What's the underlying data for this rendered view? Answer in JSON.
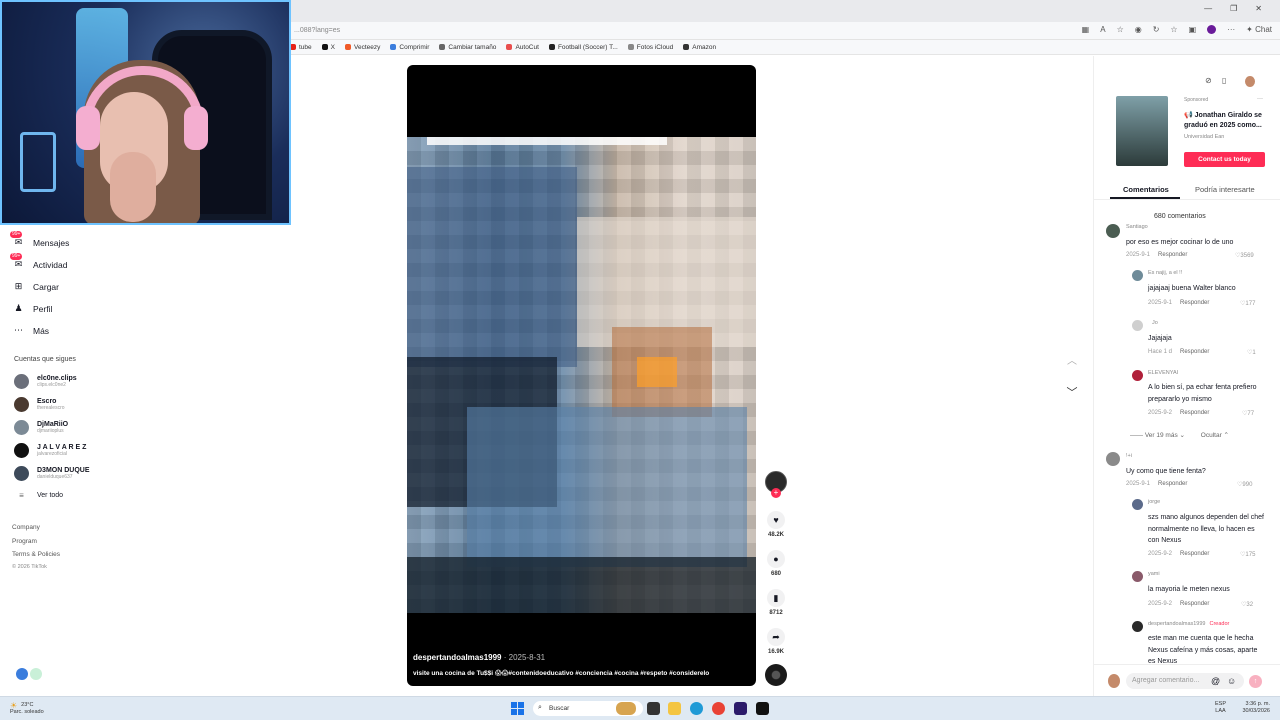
{
  "browser": {
    "url": "...088?lang=es",
    "bookmarks": [
      {
        "label": "tube",
        "color": "#e62117"
      },
      {
        "label": "X",
        "color": "#111111"
      },
      {
        "label": "Vecteezy",
        "color": "#f05a28"
      },
      {
        "label": "Comprimir",
        "color": "#3b7ddd"
      },
      {
        "label": "Cambiar tamaño",
        "color": "#666666"
      },
      {
        "label": "AutoCut",
        "color": "#e94e4e"
      },
      {
        "label": "Football (Soccer) T...",
        "color": "#222222"
      },
      {
        "label": "Fotos iCloud",
        "color": "#888888"
      },
      {
        "label": "Amazon",
        "color": "#333333"
      }
    ],
    "chat_label": "Chat"
  },
  "sidebar": {
    "nav": [
      {
        "label": "Mensajes",
        "icon": "message-icon",
        "badge": "99+"
      },
      {
        "label": "Actividad",
        "icon": "inbox-icon",
        "badge": "99+"
      },
      {
        "label": "Cargar",
        "icon": "upload-icon",
        "badge": ""
      },
      {
        "label": "Perfil",
        "icon": "profile-icon",
        "badge": ""
      },
      {
        "label": "Más",
        "icon": "more-icon",
        "badge": ""
      }
    ],
    "following_title": "Cuentas que sigues",
    "following": [
      {
        "name": "elc0ne.clips",
        "handle": "clips.elc0ne2",
        "color": "#6b6f7a"
      },
      {
        "name": "Escro",
        "handle": "therealescro",
        "color": "#4a3a30"
      },
      {
        "name": "DjMaRiiO",
        "handle": "djmariioplus",
        "color": "#7c8a96"
      },
      {
        "name": "J A L V A R E Z",
        "handle": "jalvarezoficial",
        "color": "#111111"
      },
      {
        "name": "D3MON DUQUE",
        "handle": "danielduque637",
        "color": "#3d4a5a"
      }
    ],
    "see_all": "Ver todo",
    "footer": [
      "Company",
      "Program",
      "Terms & Policies",
      "© 2026 TikTok"
    ]
  },
  "video": {
    "author": "despertandoalmas1999",
    "date": "· 2025-8-31",
    "caption": "visite una cocina de Tu$$i 😱😱#contenidoeducativo #conciencia #cocina #respeto #considerelo"
  },
  "actions": {
    "likes": "48.2K",
    "comments": "680",
    "saves": "8712",
    "shares": "16.9K"
  },
  "right_panel": {
    "ad": {
      "sponsored": "Sponsored",
      "title": "📢 Jonathan Giraldo se graduó en 2025 como...",
      "advertiser": "Universidad Ean",
      "cta": "Contact us today"
    },
    "tabs": [
      "Comentarios",
      "Podría interesarte"
    ],
    "comment_count": "680 comentarios",
    "comments": [
      {
        "user": "Santiago",
        "text": "por eso es mejor cocinar lo de uno",
        "date": "2025-9-1",
        "reply": "Responder",
        "likes": "3569"
      },
      {
        "user": "Es najij, a el !!",
        "text": "jajajaaj buena Walter blanco",
        "date": "2025-9-1",
        "reply": "Responder",
        "likes": "177"
      },
      {
        "user": "Jo",
        "text": "Jajajaja",
        "date": "Hace 1 d",
        "reply": "Responder",
        "likes": "1"
      },
      {
        "user": "ELEVENYAI",
        "text": "A lo bien sí, pa echar fenta prefiero prepararlo yo mismo",
        "date": "2025-9-2",
        "reply": "Responder",
        "likes": "77"
      },
      {
        "user": "!+i",
        "text": "Uy como que tiene fenta?",
        "date": "2025-9-1",
        "reply": "Responder",
        "likes": "990"
      },
      {
        "user": "jorge",
        "text": "szs mano algunos dependen del chef normalmente no lleva, lo hacen es con Nexus",
        "date": "2025-9-2",
        "reply": "Responder",
        "likes": "175"
      },
      {
        "user": "yami",
        "text": "la mayoria le meten nexus",
        "date": "2025-9-2",
        "reply": "Responder",
        "likes": "32"
      },
      {
        "user": "despertandoalmas1999",
        "creator": "Creador",
        "text": "este man me cuenta que le hecha Nexus cafeína y más cosas, aparte es Nexus"
      }
    ],
    "more_replies": "Ver 19 más",
    "hide": "Ocultar",
    "comment_placeholder": "Agregar comentario..."
  },
  "taskbar": {
    "temp": "23°C",
    "weather": "Parc. soleado",
    "search": "Buscar",
    "lang1": "ESP",
    "lang2": "LAA",
    "time": "3:36 p. m.",
    "date": "30/03/2026"
  }
}
